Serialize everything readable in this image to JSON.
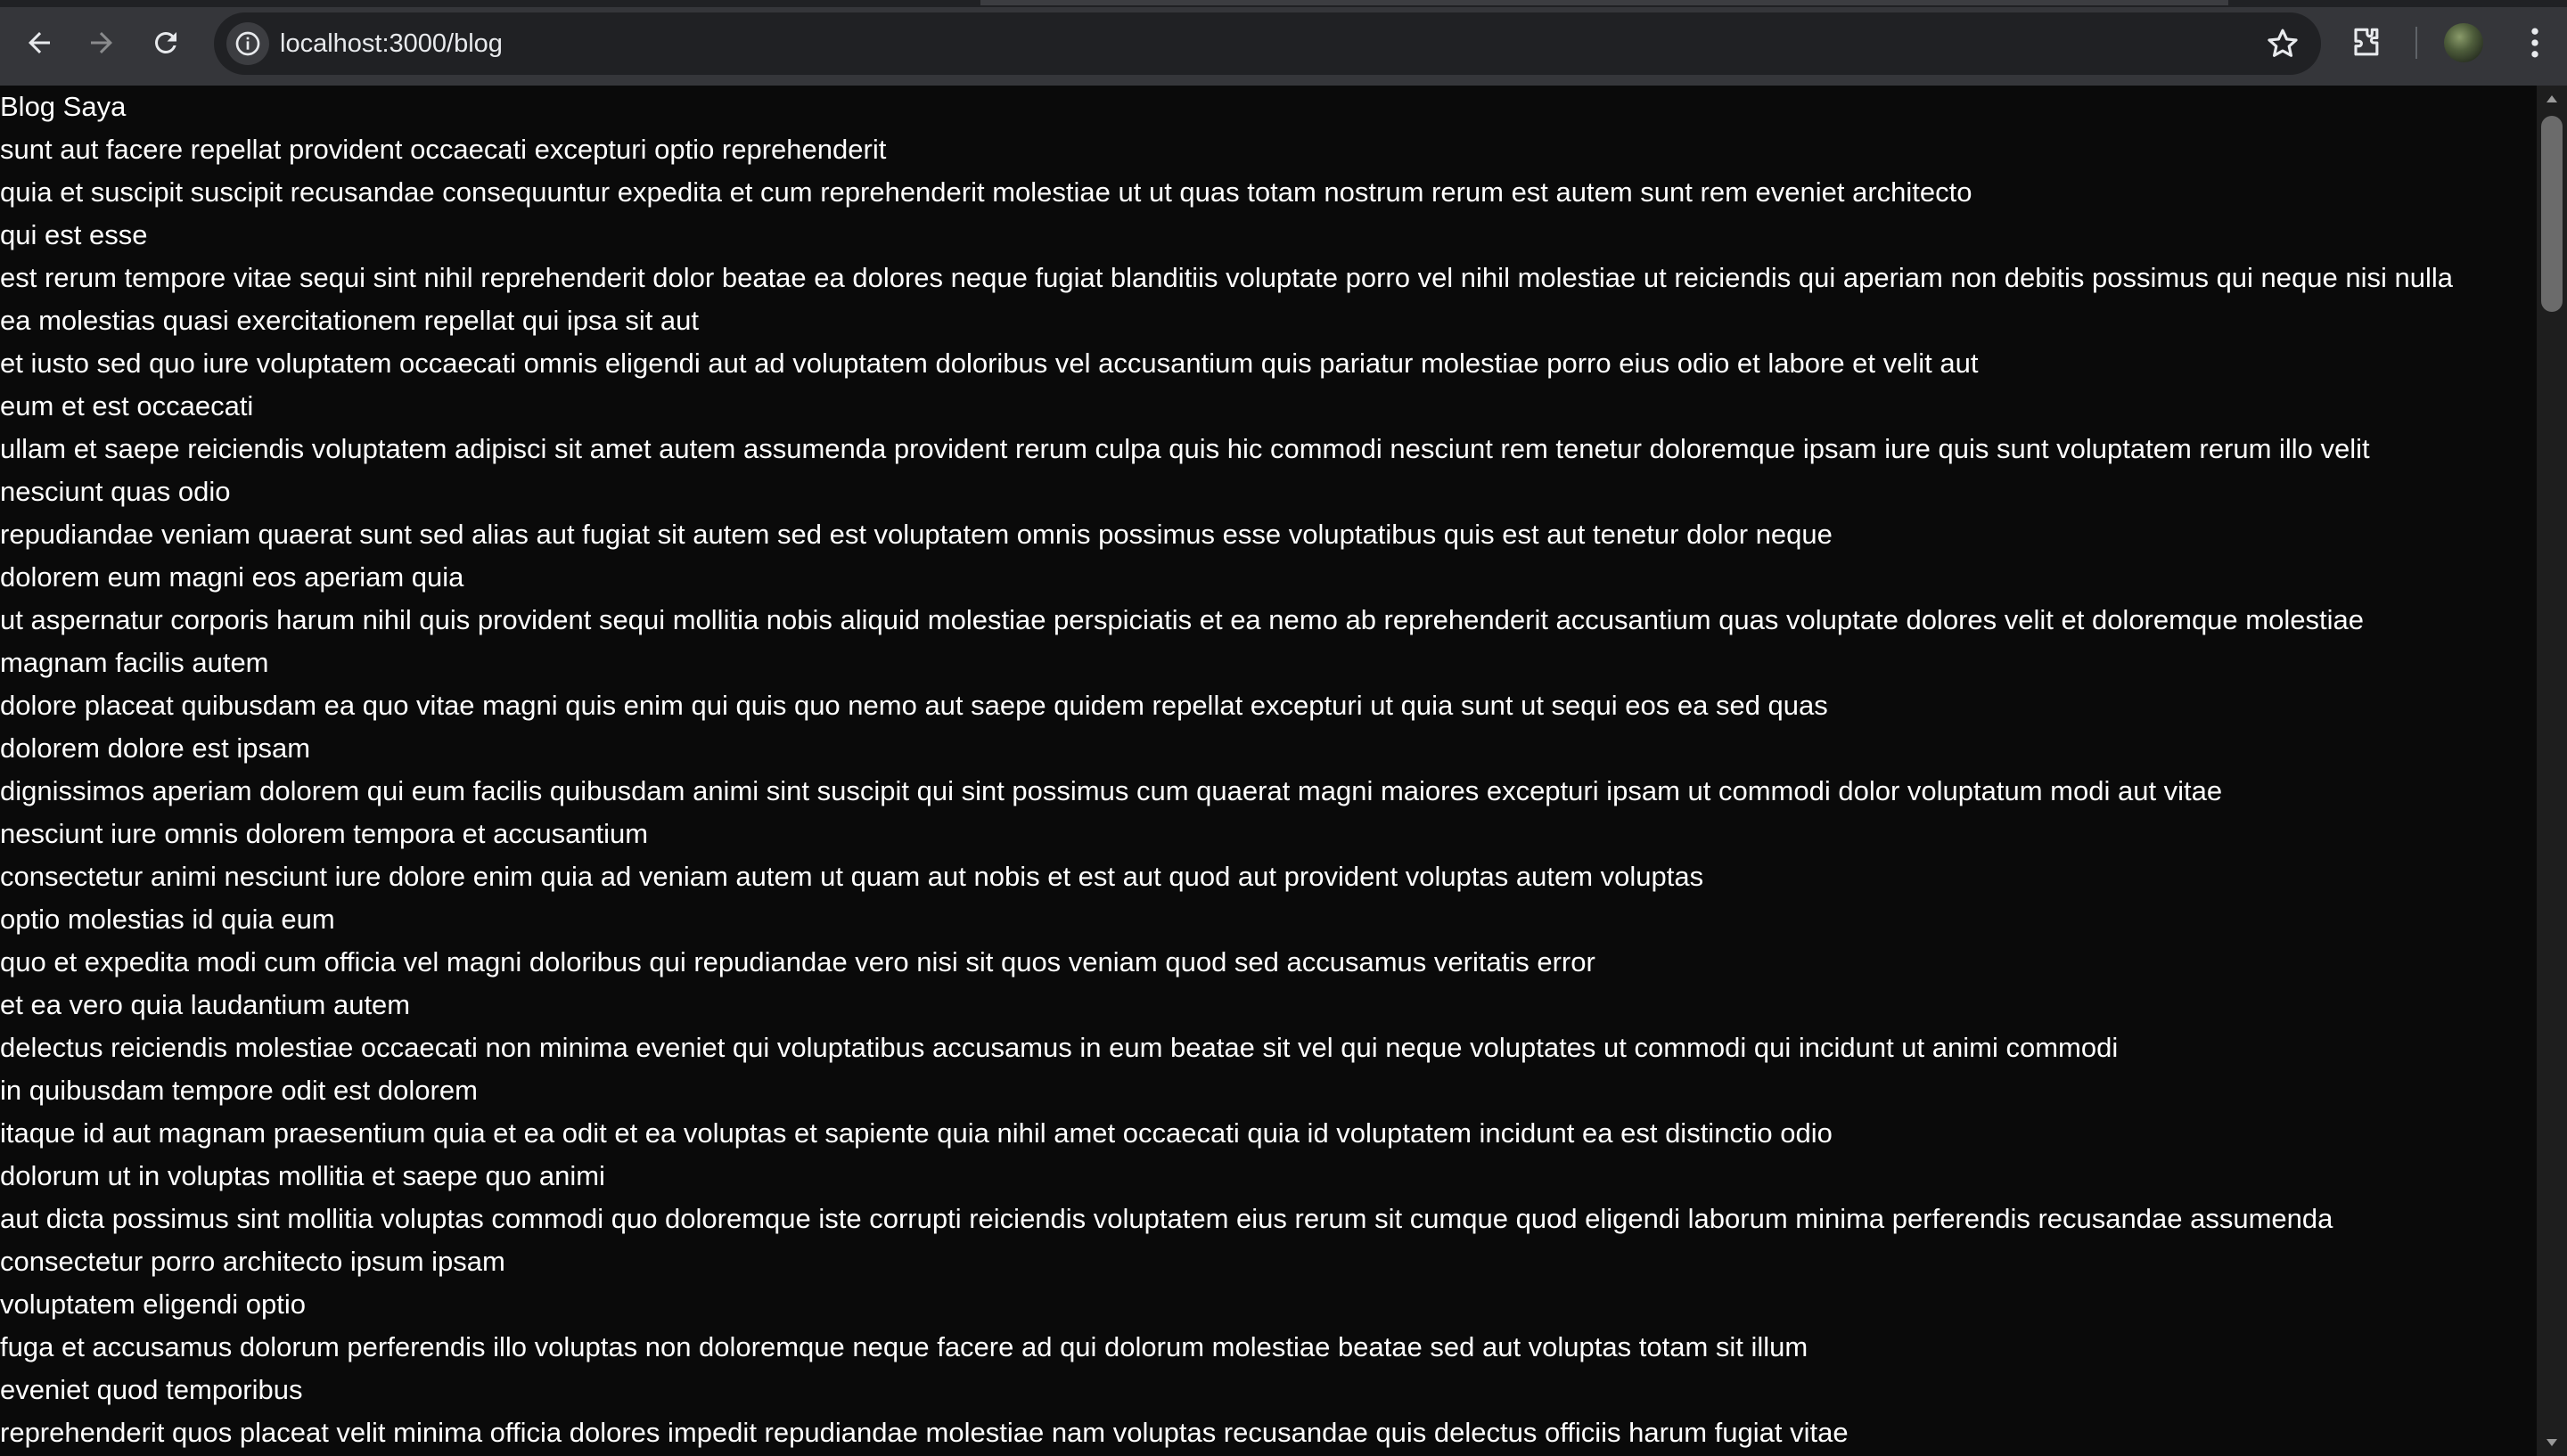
{
  "browser": {
    "url": "localhost:3000/blog",
    "icons": {
      "back": "arrow-left-icon",
      "forward": "arrow-right-icon",
      "reload": "reload-icon",
      "site_info": "info-icon",
      "bookmark": "star-icon",
      "extensions": "puzzle-icon",
      "profile": "avatar",
      "menu": "kebab-menu-icon"
    }
  },
  "page": {
    "title": "Blog Saya",
    "lines": [
      "sunt aut facere repellat provident occaecati excepturi optio reprehenderit",
      "quia et suscipit suscipit recusandae consequuntur expedita et cum reprehenderit molestiae ut ut quas totam nostrum rerum est autem sunt rem eveniet architecto",
      "qui est esse",
      "est rerum tempore vitae sequi sint nihil reprehenderit dolor beatae ea dolores neque fugiat blanditiis voluptate porro vel nihil molestiae ut reiciendis qui aperiam non debitis possimus qui neque nisi nulla",
      "ea molestias quasi exercitationem repellat qui ipsa sit aut",
      "et iusto sed quo iure voluptatem occaecati omnis eligendi aut ad voluptatem doloribus vel accusantium quis pariatur molestiae porro eius odio et labore et velit aut",
      "eum et est occaecati",
      "ullam et saepe reiciendis voluptatem adipisci sit amet autem assumenda provident rerum culpa quis hic commodi nesciunt rem tenetur doloremque ipsam iure quis sunt voluptatem rerum illo velit",
      "nesciunt quas odio",
      "repudiandae veniam quaerat sunt sed alias aut fugiat sit autem sed est voluptatem omnis possimus esse voluptatibus quis est aut tenetur dolor neque",
      "dolorem eum magni eos aperiam quia",
      "ut aspernatur corporis harum nihil quis provident sequi mollitia nobis aliquid molestiae perspiciatis et ea nemo ab reprehenderit accusantium quas voluptate dolores velit et doloremque molestiae",
      "magnam facilis autem",
      "dolore placeat quibusdam ea quo vitae magni quis enim qui quis quo nemo aut saepe quidem repellat excepturi ut quia sunt ut sequi eos ea sed quas",
      "dolorem dolore est ipsam",
      "dignissimos aperiam dolorem qui eum facilis quibusdam animi sint suscipit qui sint possimus cum quaerat magni maiores excepturi ipsam ut commodi dolor voluptatum modi aut vitae",
      "nesciunt iure omnis dolorem tempora et accusantium",
      "consectetur animi nesciunt iure dolore enim quia ad veniam autem ut quam aut nobis et est aut quod aut provident voluptas autem voluptas",
      "optio molestias id quia eum",
      "quo et expedita modi cum officia vel magni doloribus qui repudiandae vero nisi sit quos veniam quod sed accusamus veritatis error",
      "et ea vero quia laudantium autem",
      "delectus reiciendis molestiae occaecati non minima eveniet qui voluptatibus accusamus in eum beatae sit vel qui neque voluptates ut commodi qui incidunt ut animi commodi",
      "in quibusdam tempore odit est dolorem",
      "itaque id aut magnam praesentium quia et ea odit et ea voluptas et sapiente quia nihil amet occaecati quia id voluptatem incidunt ea est distinctio odio",
      "dolorum ut in voluptas mollitia et saepe quo animi",
      "aut dicta possimus sint mollitia voluptas commodi quo doloremque iste corrupti reiciendis voluptatem eius rerum sit cumque quod eligendi laborum minima perferendis recusandae assumenda",
      "consectetur porro architecto ipsum ipsam",
      "voluptatem eligendi optio",
      "fuga et accusamus dolorum perferendis illo voluptas non doloremque neque facere ad qui dolorum molestiae beatae sed aut voluptas totam sit illum",
      "eveniet quod temporibus",
      "reprehenderit quos placeat velit minima officia dolores impedit repudiandae molestiae nam voluptas recusandae quis delectus officiis harum fugiat vitae"
    ]
  }
}
